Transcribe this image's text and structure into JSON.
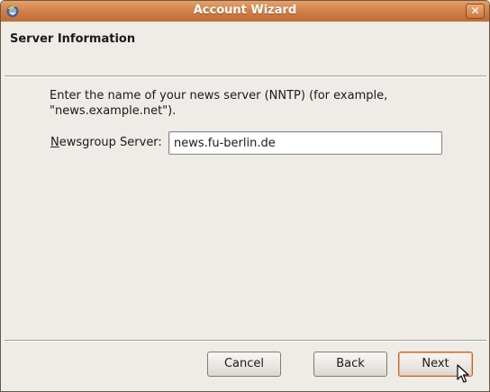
{
  "window": {
    "title": "Account Wizard",
    "close_glyph": "✕",
    "icon": "thunderbird-app-icon"
  },
  "header": {
    "title": "Server Information"
  },
  "content": {
    "description_line1": "Enter the name of your news server (NNTP) (for example,",
    "description_line2": "\"news.example.net\").",
    "field_label_mnemonic": "N",
    "field_label_rest": "ewsgroup Server:",
    "field_value": "news.fu-berlin.de"
  },
  "buttons": {
    "cancel": "Cancel",
    "back": "Back",
    "next": "Next"
  },
  "colors": {
    "titlebar": "#d2824a",
    "window_bg": "#efebe7",
    "default_button_border": "#c0642a"
  }
}
